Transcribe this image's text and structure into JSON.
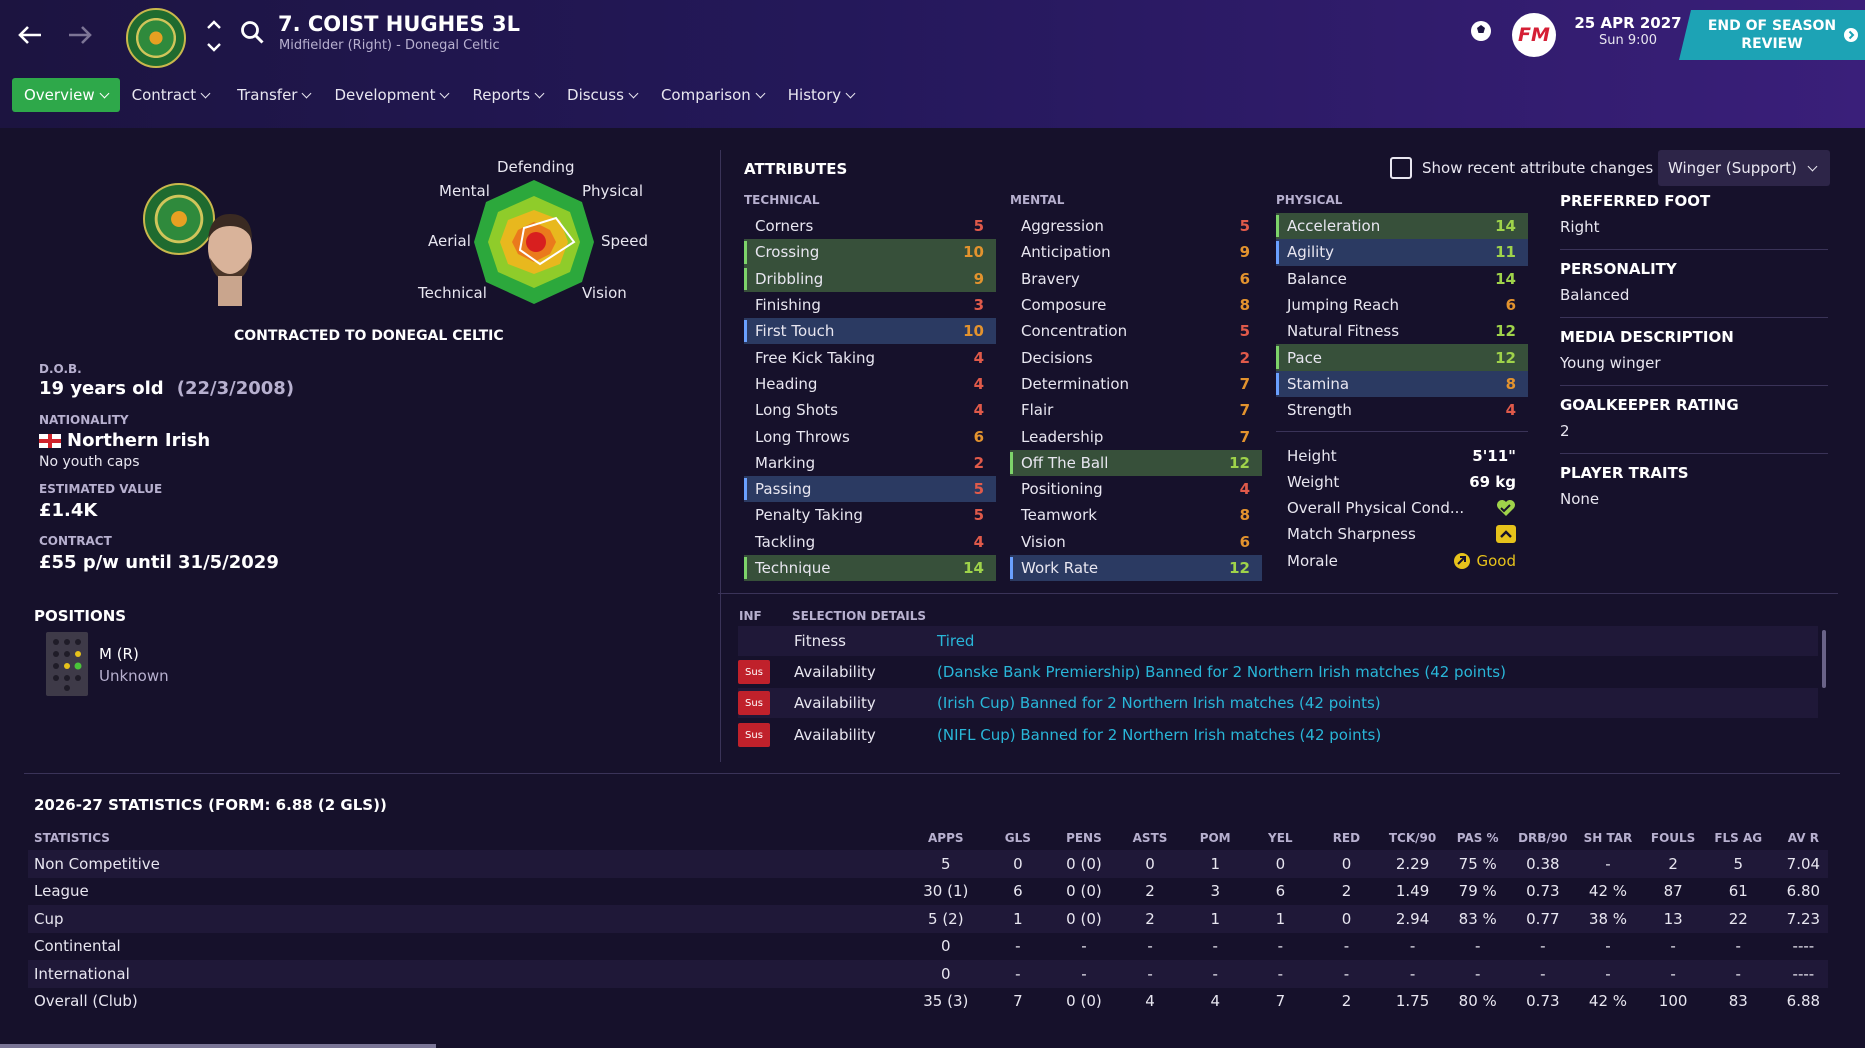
{
  "header": {
    "title": "7. COIST HUGHES 3L",
    "subtitle": "Midfielder (Right) - Donegal Celtic",
    "date": "25 APR 2027",
    "time": "Sun 9:00",
    "eos_line1": "END OF SEASON",
    "eos_line2": "REVIEW",
    "fm_label": "FM"
  },
  "menu": [
    "Overview",
    "Contract",
    "Transfer",
    "Development",
    "Reports",
    "Discuss",
    "Comparison",
    "History"
  ],
  "radar": {
    "labels": {
      "top": "Defending",
      "top_left": "Mental",
      "top_right": "Physical",
      "left": "Aerial",
      "right": "Speed",
      "bottom_left": "Technical",
      "bottom_right": "Vision"
    }
  },
  "profile": {
    "contracted_to": "CONTRACTED TO DONEGAL CELTIC",
    "dob_label": "D.O.B.",
    "age": "19 years old",
    "dob": "(22/3/2008)",
    "nationality_label": "NATIONALITY",
    "nationality": "Northern Irish",
    "youth_caps": "No youth caps",
    "value_label": "ESTIMATED VALUE",
    "value": "£1.4K",
    "contract_label": "CONTRACT",
    "contract": "£55 p/w until 31/5/2029"
  },
  "positions": {
    "title": "POSITIONS",
    "pos": "M (R)",
    "rating": "Unknown"
  },
  "attributes": {
    "title": "ATTRIBUTES",
    "show_changes": "Show recent attribute changes",
    "role": "Winger (Support)",
    "technical_title": "TECHNICAL",
    "mental_title": "MENTAL",
    "physical_title": "PHYSICAL",
    "technical": [
      {
        "name": "Corners",
        "v": "5"
      },
      {
        "name": "Crossing",
        "v": "10"
      },
      {
        "name": "Dribbling",
        "v": "9"
      },
      {
        "name": "Finishing",
        "v": "3"
      },
      {
        "name": "First Touch",
        "v": "10"
      },
      {
        "name": "Free Kick Taking",
        "v": "4"
      },
      {
        "name": "Heading",
        "v": "4"
      },
      {
        "name": "Long Shots",
        "v": "4"
      },
      {
        "name": "Long Throws",
        "v": "6"
      },
      {
        "name": "Marking",
        "v": "2"
      },
      {
        "name": "Passing",
        "v": "5"
      },
      {
        "name": "Penalty Taking",
        "v": "5"
      },
      {
        "name": "Tackling",
        "v": "4"
      },
      {
        "name": "Technique",
        "v": "14"
      }
    ],
    "mental": [
      {
        "name": "Aggression",
        "v": "5"
      },
      {
        "name": "Anticipation",
        "v": "9"
      },
      {
        "name": "Bravery",
        "v": "6"
      },
      {
        "name": "Composure",
        "v": "8"
      },
      {
        "name": "Concentration",
        "v": "5"
      },
      {
        "name": "Decisions",
        "v": "2"
      },
      {
        "name": "Determination",
        "v": "7"
      },
      {
        "name": "Flair",
        "v": "7"
      },
      {
        "name": "Leadership",
        "v": "7"
      },
      {
        "name": "Off The Ball",
        "v": "12"
      },
      {
        "name": "Positioning",
        "v": "4"
      },
      {
        "name": "Teamwork",
        "v": "8"
      },
      {
        "name": "Vision",
        "v": "6"
      },
      {
        "name": "Work Rate",
        "v": "12"
      }
    ],
    "physical": [
      {
        "name": "Acceleration",
        "v": "14"
      },
      {
        "name": "Agility",
        "v": "11"
      },
      {
        "name": "Balance",
        "v": "14"
      },
      {
        "name": "Jumping Reach",
        "v": "6"
      },
      {
        "name": "Natural Fitness",
        "v": "12"
      },
      {
        "name": "Pace",
        "v": "12"
      },
      {
        "name": "Stamina",
        "v": "8"
      },
      {
        "name": "Strength",
        "v": "4"
      }
    ],
    "height_label": "Height",
    "height": "5'11\"",
    "weight_label": "Weight",
    "weight": "69 kg",
    "condition_label": "Overall Physical Cond...",
    "sharpness_label": "Match Sharpness",
    "morale_label": "Morale",
    "morale": "Good"
  },
  "info": {
    "foot_label": "PREFERRED FOOT",
    "foot": "Right",
    "personality_label": "PERSONALITY",
    "personality": "Balanced",
    "media_label": "MEDIA DESCRIPTION",
    "media": "Young winger",
    "gk_label": "GOALKEEPER RATING",
    "gk": "2",
    "traits_label": "PLAYER TRAITS",
    "traits": "None"
  },
  "selection": {
    "inf_label": "INF",
    "title": "SELECTION DETAILS",
    "rows": [
      {
        "badge": "",
        "label": "Fitness",
        "detail": "Tired"
      },
      {
        "badge": "Sus",
        "label": "Availability",
        "detail": "(Danske Bank Premiership) Banned for 2 Northern Irish matches (42 points)"
      },
      {
        "badge": "Sus",
        "label": "Availability",
        "detail": "(Irish Cup) Banned for 2 Northern Irish matches (42 points)"
      },
      {
        "badge": "Sus",
        "label": "Availability",
        "detail": "(NIFL Cup) Banned for 2 Northern Irish matches (42 points)"
      }
    ]
  },
  "stats": {
    "title": "2026-27 STATISTICS (FORM: 6.88 (2 GLS))",
    "headers": [
      "STATISTICS",
      "APPS",
      "GLS",
      "PENS",
      "ASTS",
      "POM",
      "YEL",
      "RED",
      "TCK/90",
      "PAS %",
      "DRB/90",
      "SH TAR",
      "FOULS",
      "FLS AG",
      "AV R"
    ],
    "rows": [
      [
        "Non Competitive",
        "5",
        "0",
        "0 (0)",
        "0",
        "1",
        "0",
        "0",
        "2.29",
        "75 %",
        "0.38",
        "-",
        "2",
        "5",
        "7.04"
      ],
      [
        "League",
        "30 (1)",
        "6",
        "0 (0)",
        "2",
        "3",
        "6",
        "2",
        "1.49",
        "79 %",
        "0.73",
        "42 %",
        "87",
        "61",
        "6.80"
      ],
      [
        "Cup",
        "5 (2)",
        "1",
        "0 (0)",
        "2",
        "1",
        "1",
        "0",
        "2.94",
        "83 %",
        "0.77",
        "38 %",
        "13",
        "22",
        "7.23"
      ],
      [
        "Continental",
        "0",
        "-",
        "-",
        "-",
        "-",
        "-",
        "-",
        "-",
        "-",
        "-",
        "-",
        "-",
        "-",
        "----"
      ],
      [
        "International",
        "0",
        "-",
        "-",
        "-",
        "-",
        "-",
        "-",
        "-",
        "-",
        "-",
        "-",
        "-",
        "-",
        "----"
      ],
      [
        "Overall (Club)",
        "35 (3)",
        "7",
        "0 (0)",
        "4",
        "4",
        "7",
        "2",
        "1.75",
        "80 %",
        "0.73",
        "42 %",
        "100",
        "83",
        "6.88"
      ]
    ]
  },
  "colors": {
    "accent_green": "#2ea84a",
    "teal": "#1da3b5",
    "sus_red": "#c0212b",
    "link_blue": "#29b6d8"
  }
}
